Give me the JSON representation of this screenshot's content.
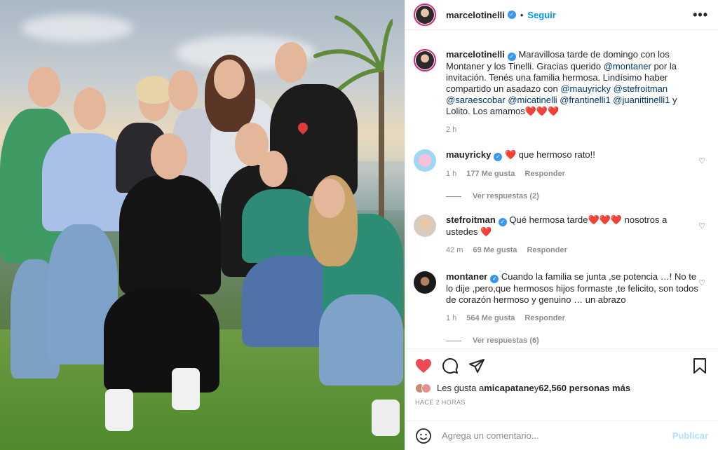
{
  "post": {
    "username": "marcelotinelli",
    "follow_label": "Seguir",
    "separator": "•",
    "more_label": "•••"
  },
  "caption": {
    "username": "marcelotinelli",
    "text_1": "Maravillosa tarde de domingo con los Montaner y los Tinelli. Gracias querido ",
    "mention_1": "@montaner",
    "text_2": " por la invitación. Tenés una familia hermosa. Lindísimo haber compartido un asadazo con ",
    "mentions_2": "@mauyricky @stefroitman @saraescobar @micatinelli @frantinelli1 @juanittinelli1",
    "text_3": " y Lolito. Los amamos",
    "hearts": "❤️❤️❤️",
    "age": "2 h"
  },
  "comments": [
    {
      "username": "mauyricky",
      "text": "que hermoso rato!!",
      "prefix_heart": "❤️",
      "age": "1 h",
      "likes": "177 Me gusta",
      "reply": "Responder",
      "replies": "Ver respuestas (2)"
    },
    {
      "username": "stefroitman",
      "text": "Qué hermosa tarde",
      "hearts_mid": "❤️❤️❤️",
      "text_after": " nosotros a ustedes",
      "hearts_end": "❤️",
      "age": "42 m",
      "likes": "69 Me gusta",
      "reply": "Responder"
    },
    {
      "username": "montaner",
      "text": "Cuando la familia se junta ,se potencia …! No te lo dije ,pero,que hermosos hijos formaste ,te felicito, son todos de corazón hermoso y genuino … un abrazo",
      "age": "1 h",
      "likes": "564 Me gusta",
      "reply": "Responder",
      "replies": "Ver respuestas (6)"
    }
  ],
  "likes": {
    "prefix": "Les gusta a ",
    "user": "micapatane",
    "mid": " y ",
    "count": "62,560 personas más",
    "time": "HACE 2 HORAS"
  },
  "add_comment": {
    "placeholder": "Agrega un comentario...",
    "publish": "Publicar"
  },
  "colors": {
    "accent": "#0095f6",
    "like_red": "#ed4956",
    "verified": "#3897f0"
  },
  "icons": [
    "heart-icon",
    "comment-icon",
    "share-icon",
    "bookmark-icon",
    "emoji-icon",
    "more-icon",
    "verified-icon"
  ]
}
